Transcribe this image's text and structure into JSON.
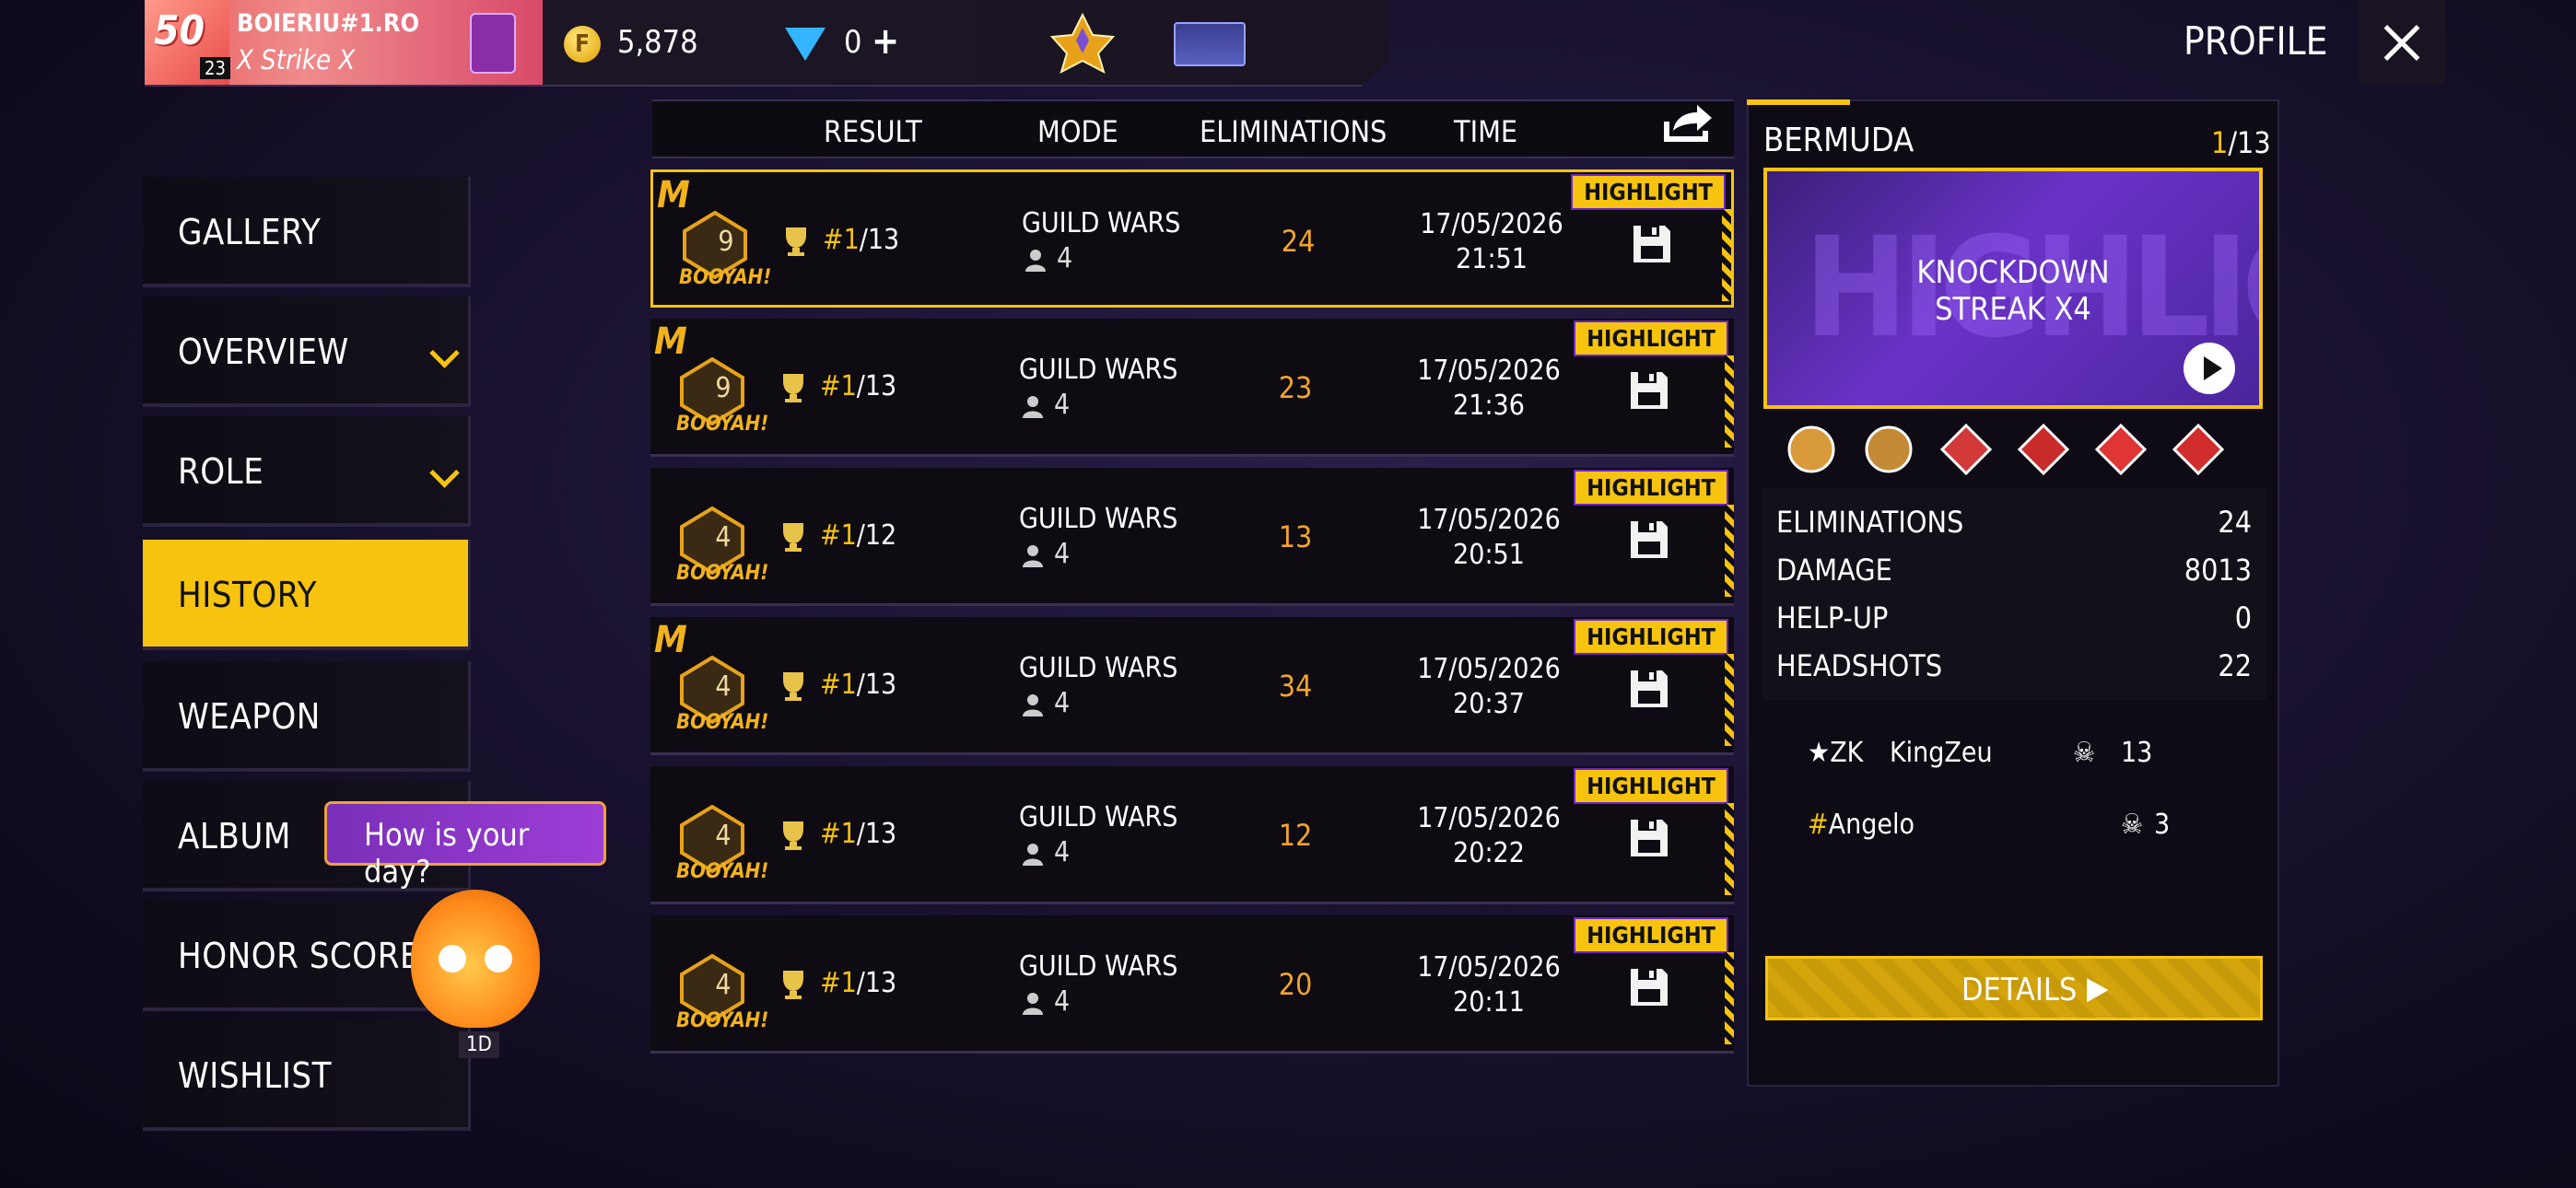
{
  "header": {
    "level": "50",
    "level_sub": "23",
    "player_name": "BOIERIU#1.RO",
    "clan": "X Strike X",
    "coins": "5,878",
    "diamonds": "0",
    "plus": "+",
    "coin_icon": "F",
    "title": "PROFILE"
  },
  "sidebar": {
    "items": [
      {
        "label": "GALLERY"
      },
      {
        "label": "OVERVIEW"
      },
      {
        "label": "ROLE"
      },
      {
        "label": "HISTORY"
      },
      {
        "label": "WEAPON"
      },
      {
        "label": "ALBUM"
      },
      {
        "label": "HONOR SCORE"
      },
      {
        "label": "WISHLIST"
      }
    ],
    "tooltip": "How is your day?",
    "pet_timer": "1D"
  },
  "table": {
    "columns": [
      "RESULT",
      "MODE",
      "ELIMINATIONS",
      "TIME"
    ],
    "highlight_label": "HIGHLIGHT",
    "booyah": "BOOYAH!",
    "rows": [
      {
        "emblem": "9",
        "rank": "#1",
        "total": "/13",
        "mode": "GUILD WARS",
        "players": "4",
        "elims": "24",
        "date": "17/05/2026",
        "time": "21:51"
      },
      {
        "emblem": "9",
        "rank": "#1",
        "total": "/13",
        "mode": "GUILD WARS",
        "players": "4",
        "elims": "23",
        "date": "17/05/2026",
        "time": "21:36"
      },
      {
        "emblem": "4",
        "rank": "#1",
        "total": "/12",
        "mode": "GUILD WARS",
        "players": "4",
        "elims": "13",
        "date": "17/05/2026",
        "time": "20:51"
      },
      {
        "emblem": "4",
        "rank": "#1",
        "total": "/13",
        "mode": "GUILD WARS",
        "players": "4",
        "elims": "34",
        "date": "17/05/2026",
        "time": "20:37"
      },
      {
        "emblem": "4",
        "rank": "#1",
        "total": "/13",
        "mode": "GUILD WARS",
        "players": "4",
        "elims": "12",
        "date": "17/05/2026",
        "time": "20:22"
      },
      {
        "emblem": "4",
        "rank": "#1",
        "total": "/13",
        "mode": "GUILD WARS",
        "players": "4",
        "elims": "20",
        "date": "17/05/2026",
        "time": "20:11"
      }
    ]
  },
  "detail": {
    "map": "BERMUDA",
    "rank_num": "1",
    "rank_total": "/13",
    "highlight_tag": "HIGHLIGHT",
    "highlight_line1": "KNOCKDOWN",
    "highlight_line2": "STREAK X4",
    "stats": [
      {
        "label": "ELIMINATIONS",
        "value": "24"
      },
      {
        "label": "DAMAGE",
        "value": "8013"
      },
      {
        "label": "HELP-UP",
        "value": "0"
      },
      {
        "label": "HEADSHOTS",
        "value": "22"
      }
    ],
    "team": [
      {
        "tag": "★ZK",
        "name": "KingZeu",
        "kills": "13"
      },
      {
        "tag": "#",
        "name": "Angelo",
        "kills": "3"
      }
    ],
    "details_button": "DETAILS"
  },
  "colors": {
    "accent": "#f6c30f",
    "elims": "#f2a52b",
    "purple": "#6a24c7"
  }
}
